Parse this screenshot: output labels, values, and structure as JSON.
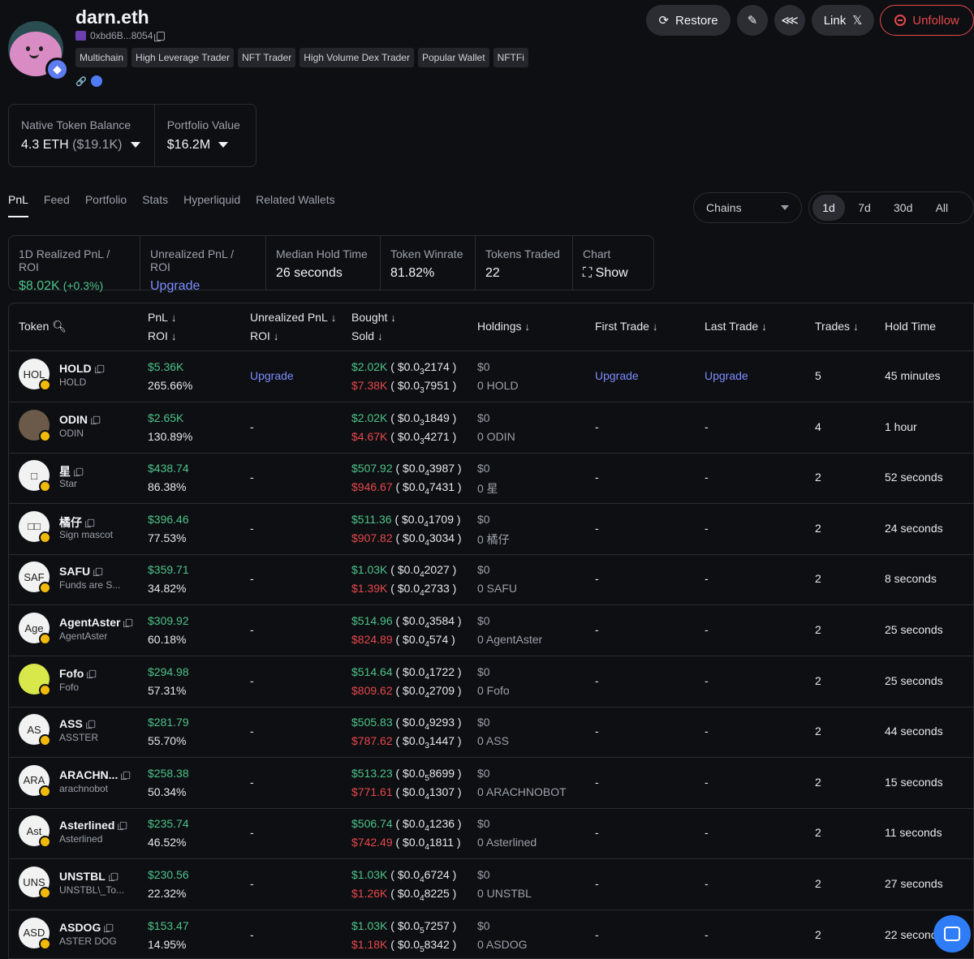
{
  "profile": {
    "name": "darn.eth",
    "address": "0xbd6B...8054",
    "tags": [
      "Multichain",
      "High Leverage Trader",
      "NFT Trader",
      "High Volume Dex Trader",
      "Popular Wallet",
      "NFTFi"
    ]
  },
  "actions": {
    "restore": "Restore",
    "link": "Link",
    "unfollow": "Unfollow"
  },
  "balance": {
    "native_label": "Native Token Balance",
    "native_value": "4.3 ETH",
    "native_usd": "($19.1K)",
    "portfolio_label": "Portfolio Value",
    "portfolio_value": "$16.2M"
  },
  "tabs": [
    "PnL",
    "Feed",
    "Portfolio",
    "Stats",
    "Hyperliquid",
    "Related Wallets"
  ],
  "filters": {
    "chains": "Chains",
    "ranges": [
      "1d",
      "7d",
      "30d",
      "All"
    ],
    "active_range": "1d"
  },
  "stats": [
    {
      "label": "1D Realized PnL / ROI",
      "value": "$8.02K",
      "extra": "(+0.3%)"
    },
    {
      "label": "Unrealized PnL / ROI",
      "value": "Upgrade"
    },
    {
      "label": "Median Hold Time",
      "value": "26 seconds"
    },
    {
      "label": "Token Winrate",
      "value": "81.82%"
    },
    {
      "label": "Tokens Traded",
      "value": "22"
    },
    {
      "label": "Chart",
      "value": "Show"
    }
  ],
  "columns": {
    "token": "Token",
    "pnl": "PnL",
    "roi": "ROI",
    "unrealized": "Unrealized PnL",
    "unrealized_roi": "ROI",
    "bought": "Bought",
    "sold": "Sold",
    "holdings": "Holdings",
    "first_trade": "First Trade",
    "last_trade": "Last Trade",
    "trades": "Trades",
    "hold_time": "Hold Time"
  },
  "rows": [
    {
      "icon": "HOL",
      "symbol": "HOLD",
      "name": "HOLD",
      "pnl": "$5.36K",
      "roi": "265.66%",
      "unrealized": "Upgrade",
      "bought": "$2.02K",
      "b_pre": "( $0.0",
      "b_sub": "3",
      "b_post": "2174 )",
      "sold": "$7.38K",
      "s_pre": "( $0.0",
      "s_sub": "3",
      "s_post": "7951 )",
      "hold_usd": "$0",
      "hold_amt": "0 HOLD",
      "first": "Upgrade",
      "last": "Upgrade",
      "trades": "5",
      "hold_time": "45 minutes"
    },
    {
      "icon": "",
      "symbol": "ODIN",
      "name": "ODIN",
      "pnl": "$2.65K",
      "roi": "130.89%",
      "unrealized": "-",
      "bought": "$2.02K",
      "b_pre": "( $0.0",
      "b_sub": "3",
      "b_post": "1849 )",
      "sold": "$4.67K",
      "s_pre": "( $0.0",
      "s_sub": "3",
      "s_post": "4271 )",
      "hold_usd": "$0",
      "hold_amt": "0 ODIN",
      "first": "-",
      "last": "-",
      "trades": "4",
      "hold_time": "1 hour"
    },
    {
      "icon": "□",
      "symbol": "星",
      "name": "Star",
      "pnl": "$438.74",
      "roi": "86.38%",
      "unrealized": "-",
      "bought": "$507.92",
      "b_pre": "( $0.0",
      "b_sub": "4",
      "b_post": "3987 )",
      "sold": "$946.67",
      "s_pre": "( $0.0",
      "s_sub": "4",
      "s_post": "7431 )",
      "hold_usd": "$0",
      "hold_amt": "0 星",
      "first": "-",
      "last": "-",
      "trades": "2",
      "hold_time": "52 seconds"
    },
    {
      "icon": "□□",
      "symbol": "橘仔",
      "name": "Sign mascot",
      "pnl": "$396.46",
      "roi": "77.53%",
      "unrealized": "-",
      "bought": "$511.36",
      "b_pre": "( $0.0",
      "b_sub": "4",
      "b_post": "1709 )",
      "sold": "$907.82",
      "s_pre": "( $0.0",
      "s_sub": "4",
      "s_post": "3034 )",
      "hold_usd": "$0",
      "hold_amt": "0 橘仔",
      "first": "-",
      "last": "-",
      "trades": "2",
      "hold_time": "24 seconds"
    },
    {
      "icon": "SAF",
      "symbol": "SAFU",
      "name": "Funds are S...",
      "pnl": "$359.71",
      "roi": "34.82%",
      "unrealized": "-",
      "bought": "$1.03K",
      "b_pre": "( $0.0",
      "b_sub": "4",
      "b_post": "2027 )",
      "sold": "$1.39K",
      "s_pre": "( $0.0",
      "s_sub": "4",
      "s_post": "2733 )",
      "hold_usd": "$0",
      "hold_amt": "0 SAFU",
      "first": "-",
      "last": "-",
      "trades": "2",
      "hold_time": "8 seconds"
    },
    {
      "icon": "Age",
      "symbol": "AgentAster",
      "name": "AgentAster",
      "pnl": "$309.92",
      "roi": "60.18%",
      "unrealized": "-",
      "bought": "$514.96",
      "b_pre": "( $0.0",
      "b_sub": "4",
      "b_post": "3584 )",
      "sold": "$824.89",
      "s_pre": "( $0.0",
      "s_sub": "4",
      "s_post": "574 )",
      "hold_usd": "$0",
      "hold_amt": "0 AgentAster",
      "first": "-",
      "last": "-",
      "trades": "2",
      "hold_time": "25 seconds"
    },
    {
      "icon": "",
      "symbol": "Fofo",
      "name": "Fofo",
      "pnl": "$294.98",
      "roi": "57.31%",
      "unrealized": "-",
      "bought": "$514.64",
      "b_pre": "( $0.0",
      "b_sub": "4",
      "b_post": "1722 )",
      "sold": "$809.62",
      "s_pre": "( $0.0",
      "s_sub": "4",
      "s_post": "2709 )",
      "hold_usd": "$0",
      "hold_amt": "0 Fofo",
      "first": "-",
      "last": "-",
      "trades": "2",
      "hold_time": "25 seconds"
    },
    {
      "icon": "AS",
      "symbol": "ASS",
      "name": "ASSTER",
      "pnl": "$281.79",
      "roi": "55.70%",
      "unrealized": "-",
      "bought": "$505.83",
      "b_pre": "( $0.0",
      "b_sub": "4",
      "b_post": "9293 )",
      "sold": "$787.62",
      "s_pre": "( $0.0",
      "s_sub": "3",
      "s_post": "1447 )",
      "hold_usd": "$0",
      "hold_amt": "0 ASS",
      "first": "-",
      "last": "-",
      "trades": "2",
      "hold_time": "44 seconds"
    },
    {
      "icon": "ARA",
      "symbol": "ARACHN...",
      "name": "arachnobot",
      "pnl": "$258.38",
      "roi": "50.34%",
      "unrealized": "-",
      "bought": "$513.23",
      "b_pre": "( $0.0",
      "b_sub": "5",
      "b_post": "8699 )",
      "sold": "$771.61",
      "s_pre": "( $0.0",
      "s_sub": "4",
      "s_post": "1307 )",
      "hold_usd": "$0",
      "hold_amt": "0 ARACHNOBOT",
      "first": "-",
      "last": "-",
      "trades": "2",
      "hold_time": "15 seconds"
    },
    {
      "icon": "Ast",
      "symbol": "Asterlined",
      "name": "Asterlined",
      "pnl": "$235.74",
      "roi": "46.52%",
      "unrealized": "-",
      "bought": "$506.74",
      "b_pre": "( $0.0",
      "b_sub": "4",
      "b_post": "1236 )",
      "sold": "$742.49",
      "s_pre": "( $0.0",
      "s_sub": "4",
      "s_post": "1811 )",
      "hold_usd": "$0",
      "hold_amt": "0 Asterlined",
      "first": "-",
      "last": "-",
      "trades": "2",
      "hold_time": "11 seconds"
    },
    {
      "icon": "UNS",
      "symbol": "UNSTBL",
      "name": "UNSTBL\\_To...",
      "pnl": "$230.56",
      "roi": "22.32%",
      "unrealized": "-",
      "bought": "$1.03K",
      "b_pre": "( $0.0",
      "b_sub": "4",
      "b_post": "6724 )",
      "sold": "$1.26K",
      "s_pre": "( $0.0",
      "s_sub": "4",
      "s_post": "8225 )",
      "hold_usd": "$0",
      "hold_amt": "0 UNSTBL",
      "first": "-",
      "last": "-",
      "trades": "2",
      "hold_time": "27 seconds"
    },
    {
      "icon": "ASD",
      "symbol": "ASDOG",
      "name": "ASTER DOG",
      "pnl": "$153.47",
      "roi": "14.95%",
      "unrealized": "-",
      "bought": "$1.03K",
      "b_pre": "( $0.0",
      "b_sub": "5",
      "b_post": "7257 )",
      "sold": "$1.18K",
      "s_pre": "( $0.0",
      "s_sub": "5",
      "s_post": "8342 )",
      "hold_usd": "$0",
      "hold_amt": "0 ASDOG",
      "first": "-",
      "last": "-",
      "trades": "2",
      "hold_time": "22 seconds"
    }
  ]
}
